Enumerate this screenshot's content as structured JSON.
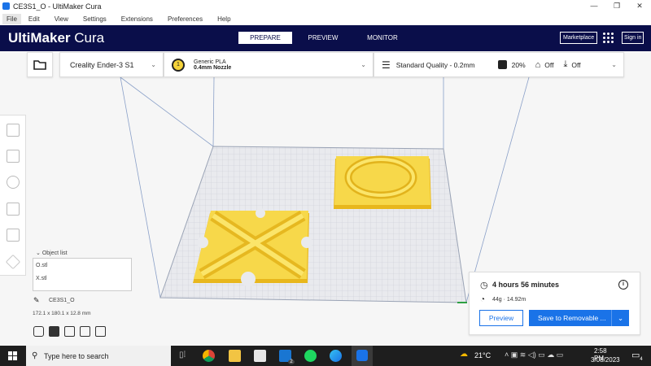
{
  "window": {
    "title": "CE3S1_O - UltiMaker Cura",
    "controls": [
      "—",
      "❐",
      "✕"
    ]
  },
  "menu": [
    "File",
    "Edit",
    "View",
    "Settings",
    "Extensions",
    "Preferences",
    "Help"
  ],
  "header": {
    "brand_bold": "UltiMaker",
    "brand_light": " Cura",
    "stages": [
      "PREPARE",
      "PREVIEW",
      "MONITOR"
    ],
    "marketplace": "Marketplace",
    "signin": "Sign in"
  },
  "toolbar": {
    "printer": "Creality Ender-3 S1",
    "material": "Generic PLA",
    "nozzle": "0.4mm Nozzle",
    "extruder": "1",
    "quality": "Standard Quality - 0.2mm",
    "infill": "20%",
    "support": "Off",
    "adhesion": "Off"
  },
  "objects": {
    "label": "Object list",
    "items": [
      "O.stl",
      "X.stl"
    ],
    "name": "CE3S1_O",
    "dimensions": "172.1 x 180.1 x 12.8 mm"
  },
  "job": {
    "time": "4 hours 56 minutes",
    "material": "44g · 14.92m",
    "preview": "Preview",
    "save": "Save to Removable ..."
  },
  "taskbar": {
    "search": "Type here to search",
    "temp": "21°C",
    "time": "2:58 PM",
    "date": "3/08/2023",
    "notifications": "4",
    "mail_badge": "2"
  },
  "colors": {
    "header": "#0a0e4a",
    "accent": "#1a73e8",
    "model": "#f5d33a"
  }
}
